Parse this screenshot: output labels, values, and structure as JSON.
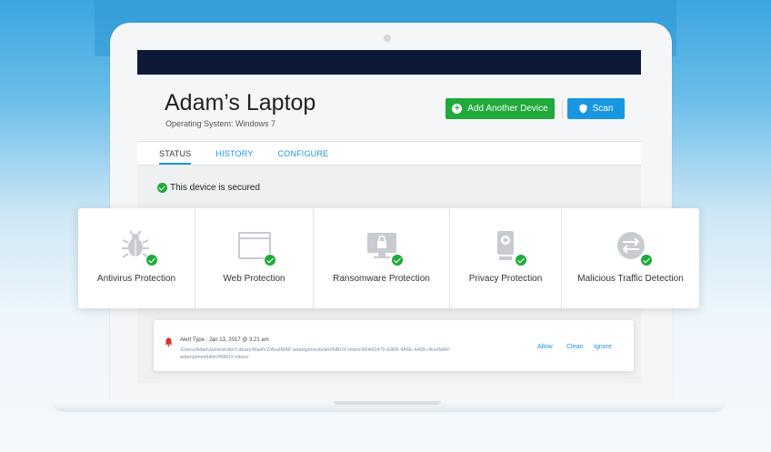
{
  "device": {
    "title": "Adam’s Laptop",
    "os_label": "Operating System: Windows 7"
  },
  "buttons": {
    "add_device": "Add Another Device",
    "scan": "Scan"
  },
  "tabs": [
    {
      "label": "STATUS",
      "active": true
    },
    {
      "label": "HISTORY",
      "active": false
    },
    {
      "label": "CONFIGURE",
      "active": false
    }
  ],
  "status_message": "This device is secured",
  "protections": [
    {
      "label": "Antivirus Protection",
      "icon": "bug-icon"
    },
    {
      "label": "Web Protection",
      "icon": "browser-window-icon"
    },
    {
      "label": "Ransomware Protection",
      "icon": "locked-monitor-icon"
    },
    {
      "label": "Privacy Protection",
      "icon": "webcam-icon"
    },
    {
      "label": "Malicious Traffic Detection",
      "icon": "traffic-arrows-icon"
    }
  ],
  "alert": {
    "type_line": "Alert Type : Jan 13, 2017 @ 3:21 am",
    "path": "/Users/AdamJamesfuller/Library/Mail/V2/AcetMAP-adamjamesfuller/INBOX.mbox/AFA00479-E808-4A6E-A405-/AcetMAP-adamjamesfuller/INBOX.mbox/",
    "actions": {
      "allow": "Allow",
      "clean": "Clean",
      "ignore": "Ignore"
    }
  },
  "colors": {
    "navy_bar": "#0c1a35",
    "green": "#1faa3a",
    "blue": "#1996e0",
    "alert_red": "#e0302a"
  }
}
